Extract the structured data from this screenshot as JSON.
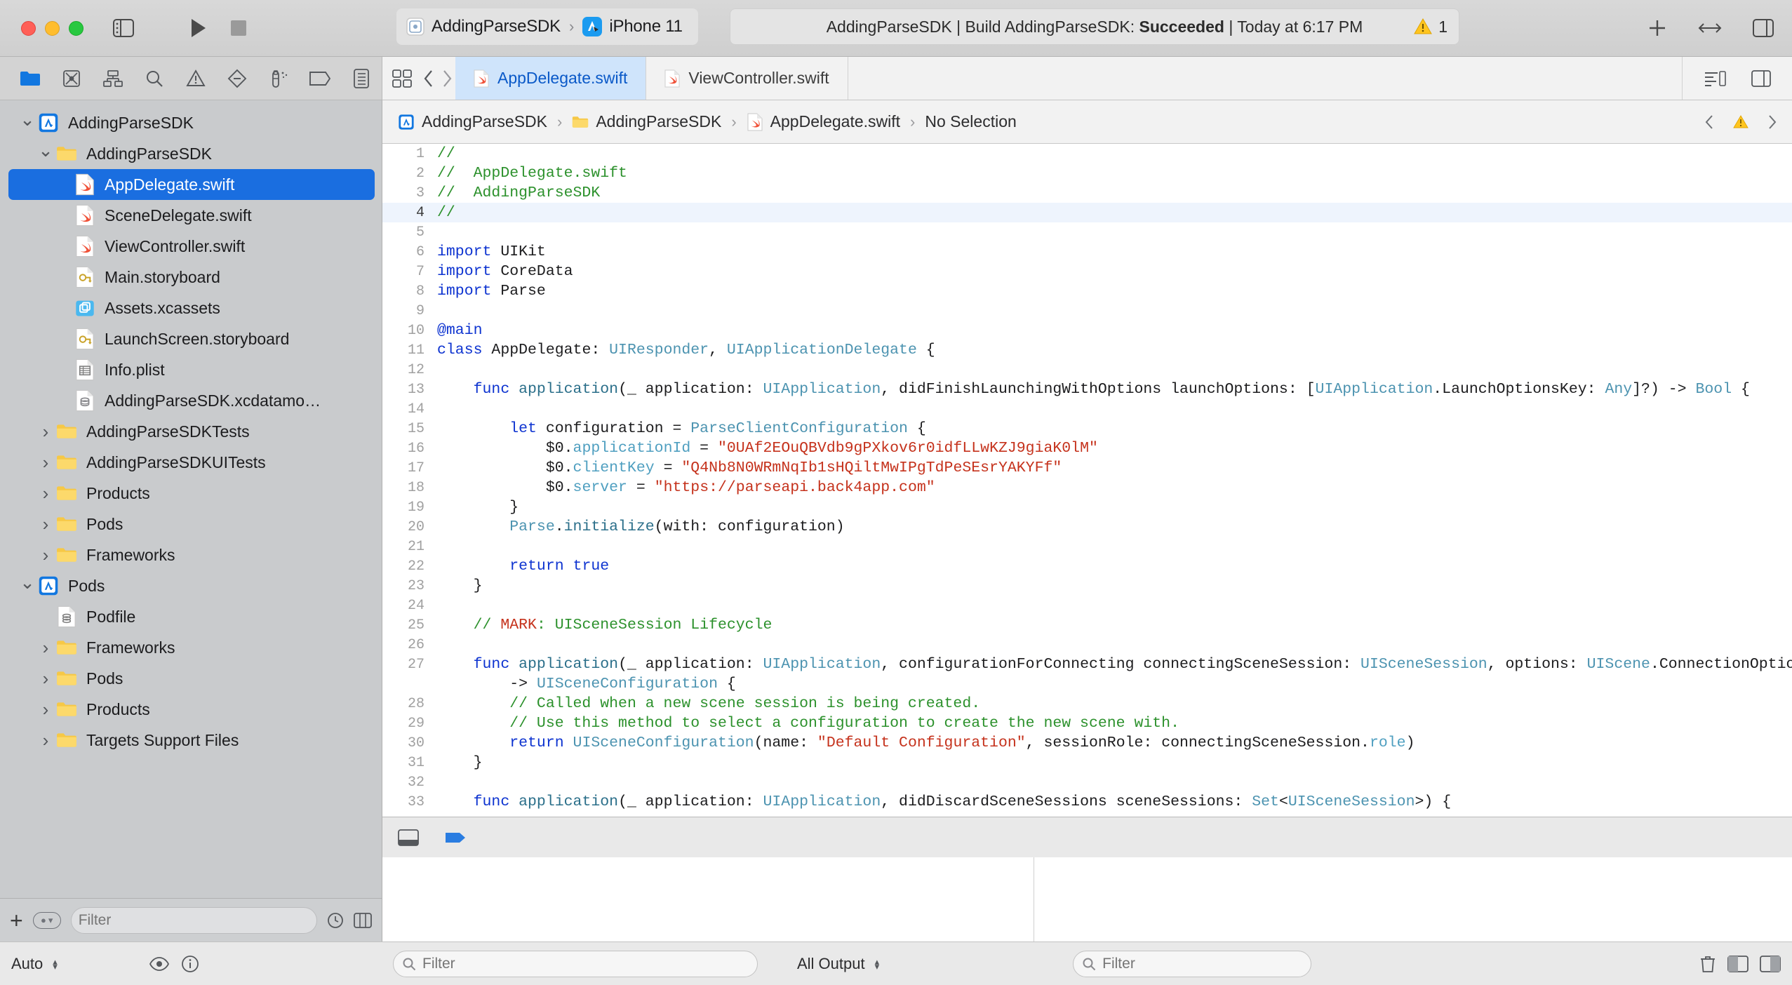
{
  "window": {
    "traffic_lights": [
      "close",
      "minimize",
      "zoom"
    ]
  },
  "toolbar": {
    "sidebar_toggle": "sidebar-toggle-icon",
    "run_label": "run-button",
    "stop_label": "stop-button",
    "scheme": {
      "project": "AddingParseSDK",
      "separator": "›",
      "destination": "iPhone 11"
    },
    "status": {
      "text_prefix": "AddingParseSDK | Build AddingParseSDK: ",
      "result": "Succeeded",
      "text_suffix": " | Today at 6:17 PM",
      "warning_count": "1"
    },
    "add_label": "+",
    "toggle_label": "↔"
  },
  "navigator_toolbar": {
    "items": [
      {
        "name": "project-navigator-icon",
        "title": "Show the Project navigator",
        "active": true
      },
      {
        "name": "source-control-navigator-icon",
        "title": "Show the Source Control navigator",
        "active": false
      },
      {
        "name": "symbol-navigator-icon",
        "title": "Show the Symbol navigator",
        "active": false
      },
      {
        "name": "find-navigator-icon",
        "title": "Show the Find navigator",
        "active": false
      },
      {
        "name": "issue-navigator-icon",
        "title": "Show the Issue navigator",
        "active": false
      },
      {
        "name": "test-navigator-icon",
        "title": "Show the Test navigator",
        "active": false
      },
      {
        "name": "debug-navigator-icon",
        "title": "Show the Debug navigator",
        "active": false
      },
      {
        "name": "breakpoint-navigator-icon",
        "title": "Show the Breakpoint navigator",
        "active": false
      },
      {
        "name": "report-navigator-icon",
        "title": "Show the Report navigator",
        "active": false
      }
    ]
  },
  "sidebar": {
    "tree": [
      {
        "label": "AddingParseSDK",
        "indent": 0,
        "icon": "xcode-project-icon",
        "disclosure": "open",
        "selected": false
      },
      {
        "label": "AddingParseSDK",
        "indent": 1,
        "icon": "folder-icon",
        "disclosure": "open",
        "selected": false
      },
      {
        "label": "AppDelegate.swift",
        "indent": 2,
        "icon": "swift-file-icon",
        "disclosure": "none",
        "selected": true
      },
      {
        "label": "SceneDelegate.swift",
        "indent": 2,
        "icon": "swift-file-icon",
        "disclosure": "none",
        "selected": false
      },
      {
        "label": "ViewController.swift",
        "indent": 2,
        "icon": "swift-file-icon",
        "disclosure": "none",
        "selected": false
      },
      {
        "label": "Main.storyboard",
        "indent": 2,
        "icon": "storyboard-file-icon",
        "disclosure": "none",
        "selected": false
      },
      {
        "label": "Assets.xcassets",
        "indent": 2,
        "icon": "assets-catalog-icon",
        "disclosure": "none",
        "selected": false
      },
      {
        "label": "LaunchScreen.storyboard",
        "indent": 2,
        "icon": "storyboard-file-icon",
        "disclosure": "none",
        "selected": false
      },
      {
        "label": "Info.plist",
        "indent": 2,
        "icon": "plist-file-icon",
        "disclosure": "none",
        "selected": false
      },
      {
        "label": "AddingParseSDK.xcdatamo…",
        "indent": 2,
        "icon": "datamodel-file-icon",
        "disclosure": "none",
        "selected": false
      },
      {
        "label": "AddingParseSDKTests",
        "indent": 1,
        "icon": "folder-icon",
        "disclosure": "closed",
        "selected": false
      },
      {
        "label": "AddingParseSDKUITests",
        "indent": 1,
        "icon": "folder-icon",
        "disclosure": "closed",
        "selected": false
      },
      {
        "label": "Products",
        "indent": 1,
        "icon": "folder-icon",
        "disclosure": "closed",
        "selected": false
      },
      {
        "label": "Pods",
        "indent": 1,
        "icon": "folder-icon",
        "disclosure": "closed",
        "selected": false
      },
      {
        "label": "Frameworks",
        "indent": 1,
        "icon": "folder-icon",
        "disclosure": "closed",
        "selected": false
      },
      {
        "label": "Pods",
        "indent": 0,
        "icon": "xcode-project-blue-icon",
        "disclosure": "open",
        "selected": false
      },
      {
        "label": "Podfile",
        "indent": 1,
        "icon": "podfile-icon",
        "disclosure": "none",
        "selected": false
      },
      {
        "label": "Frameworks",
        "indent": 1,
        "icon": "folder-icon",
        "disclosure": "closed",
        "selected": false
      },
      {
        "label": "Pods",
        "indent": 1,
        "icon": "folder-icon",
        "disclosure": "closed",
        "selected": false
      },
      {
        "label": "Products",
        "indent": 1,
        "icon": "folder-icon",
        "disclosure": "closed",
        "selected": false
      },
      {
        "label": "Targets Support Files",
        "indent": 1,
        "icon": "folder-icon",
        "disclosure": "closed",
        "selected": false
      }
    ],
    "footer": {
      "add_label": "+",
      "filter_placeholder": "Filter"
    }
  },
  "tabbar": {
    "tabs": [
      {
        "label": "AppDelegate.swift",
        "icon": "swift-file-icon",
        "active": true
      },
      {
        "label": "ViewController.swift",
        "icon": "swift-file-icon",
        "active": false
      }
    ]
  },
  "breadcrumb": {
    "items": [
      {
        "label": "AddingParseSDK",
        "icon": "xcode-project-icon"
      },
      {
        "label": "AddingParseSDK",
        "icon": "folder-icon"
      },
      {
        "label": "AppDelegate.swift",
        "icon": "swift-file-icon"
      },
      {
        "label": "No Selection",
        "icon": "none"
      }
    ],
    "separator": "›",
    "warning_count": "1"
  },
  "editor": {
    "current_line": 4,
    "lines": [
      {
        "n": 1,
        "tokens": [
          {
            "t": "//",
            "c": "c-cmt"
          }
        ]
      },
      {
        "n": 2,
        "tokens": [
          {
            "t": "//  AppDelegate.swift",
            "c": "c-cmt"
          }
        ]
      },
      {
        "n": 3,
        "tokens": [
          {
            "t": "//  AddingParseSDK",
            "c": "c-cmt"
          }
        ]
      },
      {
        "n": 4,
        "tokens": [
          {
            "t": "//",
            "c": "c-cmt"
          }
        ]
      },
      {
        "n": 5,
        "tokens": []
      },
      {
        "n": 6,
        "tokens": [
          {
            "t": "import",
            "c": "c-kw"
          },
          {
            "t": " UIKit",
            "c": ""
          }
        ]
      },
      {
        "n": 7,
        "tokens": [
          {
            "t": "import",
            "c": "c-kw"
          },
          {
            "t": " CoreData",
            "c": ""
          }
        ]
      },
      {
        "n": 8,
        "tokens": [
          {
            "t": "import",
            "c": "c-kw"
          },
          {
            "t": " Parse",
            "c": ""
          }
        ]
      },
      {
        "n": 9,
        "tokens": []
      },
      {
        "n": 10,
        "tokens": [
          {
            "t": "@main",
            "c": "c-attr"
          }
        ]
      },
      {
        "n": 11,
        "tokens": [
          {
            "t": "class",
            "c": "c-kw"
          },
          {
            "t": " AppDelegate: ",
            "c": ""
          },
          {
            "t": "UIResponder",
            "c": "c-typ"
          },
          {
            "t": ", ",
            "c": ""
          },
          {
            "t": "UIApplicationDelegate",
            "c": "c-typ"
          },
          {
            "t": " {",
            "c": ""
          }
        ]
      },
      {
        "n": 12,
        "tokens": []
      },
      {
        "n": 13,
        "tokens": [
          {
            "t": "    ",
            "c": ""
          },
          {
            "t": "func",
            "c": "c-kw"
          },
          {
            "t": " ",
            "c": ""
          },
          {
            "t": "application",
            "c": "c-fn"
          },
          {
            "t": "(_ application: ",
            "c": ""
          },
          {
            "t": "UIApplication",
            "c": "c-typ"
          },
          {
            "t": ", didFinishLaunchingWithOptions launchOptions: [",
            "c": ""
          },
          {
            "t": "UIApplication",
            "c": "c-typ"
          },
          {
            "t": ".LaunchOptionsKey",
            "c": ""
          },
          {
            "t": ": ",
            "c": ""
          },
          {
            "t": "Any",
            "c": "c-typ"
          },
          {
            "t": "]?) -> ",
            "c": ""
          },
          {
            "t": "Bool",
            "c": "c-typ"
          },
          {
            "t": " {",
            "c": ""
          }
        ]
      },
      {
        "n": 14,
        "tokens": []
      },
      {
        "n": 15,
        "tokens": [
          {
            "t": "        ",
            "c": ""
          },
          {
            "t": "let",
            "c": "c-kw"
          },
          {
            "t": " configuration = ",
            "c": ""
          },
          {
            "t": "ParseClientConfiguration",
            "c": "c-typ"
          },
          {
            "t": " {",
            "c": ""
          }
        ]
      },
      {
        "n": 16,
        "tokens": [
          {
            "t": "            $0.",
            "c": ""
          },
          {
            "t": "applicationId",
            "c": "c-prop"
          },
          {
            "t": " = ",
            "c": ""
          },
          {
            "t": "\"0UAf2EOuQBVdb9gPXkov6r0idfLLwKZJ9giaK0lM\"",
            "c": "c-str"
          }
        ]
      },
      {
        "n": 17,
        "tokens": [
          {
            "t": "            $0.",
            "c": ""
          },
          {
            "t": "clientKey",
            "c": "c-prop"
          },
          {
            "t": " = ",
            "c": ""
          },
          {
            "t": "\"Q4Nb8N0WRmNqIb1sHQiltMwIPgTdPeSEsrYAKYFf\"",
            "c": "c-str"
          }
        ]
      },
      {
        "n": 18,
        "tokens": [
          {
            "t": "            $0.",
            "c": ""
          },
          {
            "t": "server",
            "c": "c-prop"
          },
          {
            "t": " = ",
            "c": ""
          },
          {
            "t": "\"https://parseapi.back4app.com\"",
            "c": "c-str"
          }
        ]
      },
      {
        "n": 19,
        "tokens": [
          {
            "t": "        }",
            "c": ""
          }
        ]
      },
      {
        "n": 20,
        "tokens": [
          {
            "t": "        ",
            "c": ""
          },
          {
            "t": "Parse",
            "c": "c-typ"
          },
          {
            "t": ".",
            "c": ""
          },
          {
            "t": "initialize",
            "c": "c-fn"
          },
          {
            "t": "(with: configuration)",
            "c": ""
          }
        ]
      },
      {
        "n": 21,
        "tokens": []
      },
      {
        "n": 22,
        "tokens": [
          {
            "t": "        ",
            "c": ""
          },
          {
            "t": "return",
            "c": "c-kw"
          },
          {
            "t": " ",
            "c": ""
          },
          {
            "t": "true",
            "c": "c-kw"
          }
        ]
      },
      {
        "n": 23,
        "tokens": [
          {
            "t": "    }",
            "c": ""
          }
        ]
      },
      {
        "n": 24,
        "tokens": []
      },
      {
        "n": 25,
        "tokens": [
          {
            "t": "    // ",
            "c": "c-cmt"
          },
          {
            "t": "MARK",
            "c": "c-str"
          },
          {
            "t": ": UISceneSession Lifecycle",
            "c": "c-cmt"
          }
        ]
      },
      {
        "n": 26,
        "tokens": []
      },
      {
        "n": 27,
        "tokens": [
          {
            "t": "    ",
            "c": ""
          },
          {
            "t": "func",
            "c": "c-kw"
          },
          {
            "t": " ",
            "c": ""
          },
          {
            "t": "application",
            "c": "c-fn"
          },
          {
            "t": "(_ application: ",
            "c": ""
          },
          {
            "t": "UIApplication",
            "c": "c-typ"
          },
          {
            "t": ", configurationForConnecting connectingSceneSession: ",
            "c": ""
          },
          {
            "t": "UISceneSession",
            "c": "c-typ"
          },
          {
            "t": ", options: ",
            "c": ""
          },
          {
            "t": "UIScene",
            "c": "c-typ"
          },
          {
            "t": ".ConnectionOptions",
            "c": ""
          }
        ]
      },
      {
        "n": "",
        "tokens": [
          {
            "t": "        -> ",
            "c": ""
          },
          {
            "t": "UISceneConfiguration",
            "c": "c-typ"
          },
          {
            "t": " {",
            "c": ""
          }
        ],
        "cont": true
      },
      {
        "n": 28,
        "tokens": [
          {
            "t": "        // Called when a new scene session is being created.",
            "c": "c-cmt"
          }
        ]
      },
      {
        "n": 29,
        "tokens": [
          {
            "t": "        // Use this method to select a configuration to create the new scene with.",
            "c": "c-cmt"
          }
        ]
      },
      {
        "n": 30,
        "tokens": [
          {
            "t": "        ",
            "c": ""
          },
          {
            "t": "return",
            "c": "c-kw"
          },
          {
            "t": " ",
            "c": ""
          },
          {
            "t": "UISceneConfiguration",
            "c": "c-typ"
          },
          {
            "t": "(name: ",
            "c": ""
          },
          {
            "t": "\"Default Configuration\"",
            "c": "c-str"
          },
          {
            "t": ", sessionRole: connectingSceneSession.",
            "c": ""
          },
          {
            "t": "role",
            "c": "c-prop"
          },
          {
            "t": ")",
            "c": ""
          }
        ]
      },
      {
        "n": 31,
        "tokens": [
          {
            "t": "    }",
            "c": ""
          }
        ]
      },
      {
        "n": 32,
        "tokens": []
      },
      {
        "n": 33,
        "tokens": [
          {
            "t": "    ",
            "c": ""
          },
          {
            "t": "func",
            "c": "c-kw"
          },
          {
            "t": " ",
            "c": ""
          },
          {
            "t": "application",
            "c": "c-fn"
          },
          {
            "t": "(_ application: ",
            "c": ""
          },
          {
            "t": "UIApplication",
            "c": "c-typ"
          },
          {
            "t": ", didDiscardSceneSessions sceneSessions: ",
            "c": ""
          },
          {
            "t": "Set",
            "c": "c-typ"
          },
          {
            "t": "<",
            "c": ""
          },
          {
            "t": "UISceneSession",
            "c": "c-typ"
          },
          {
            "t": ">) {",
            "c": ""
          }
        ]
      }
    ]
  },
  "debug_bar": {
    "auto_label": "Auto",
    "all_output_label": "All Output",
    "console_filter_placeholder": "Filter",
    "variables_filter_placeholder": "Filter"
  }
}
